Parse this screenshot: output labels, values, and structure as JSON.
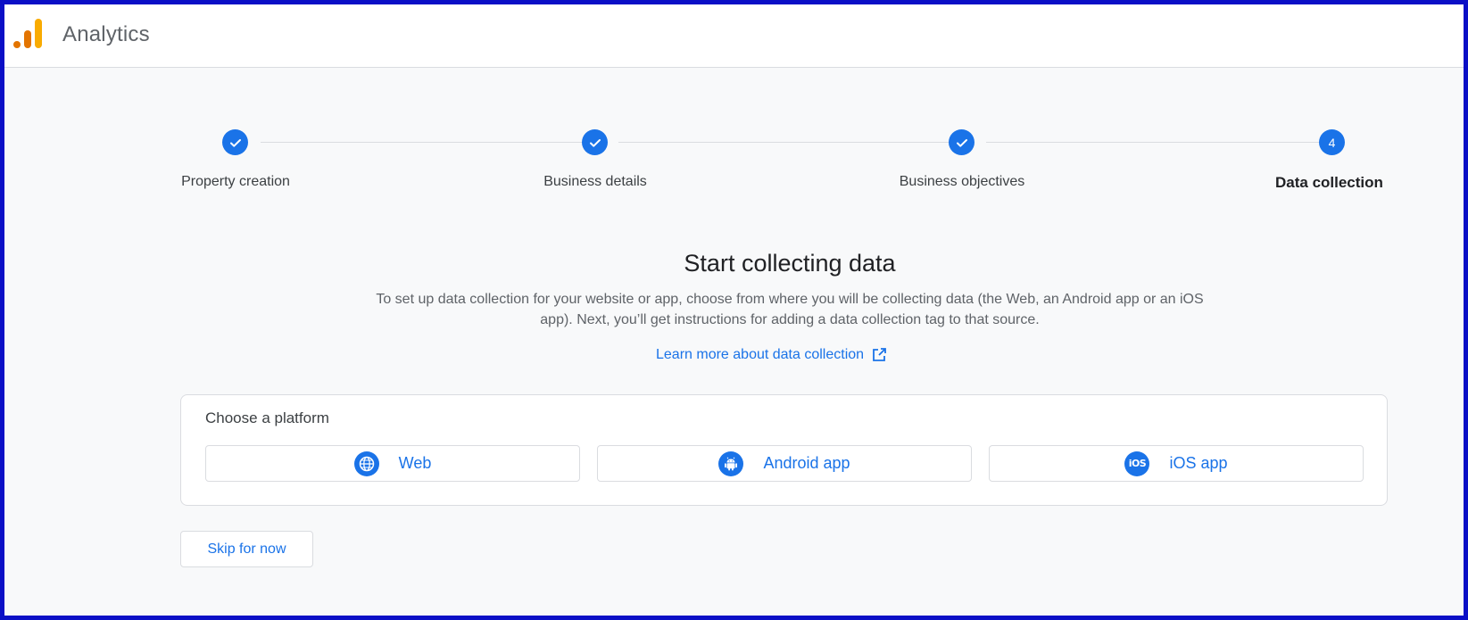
{
  "app": {
    "title": "Analytics",
    "brand_colors": {
      "orange": "#F9AB00",
      "dark_orange": "#E37400"
    }
  },
  "stepper": {
    "steps": [
      {
        "label": "Property creation",
        "status": "complete",
        "icon": "check-icon"
      },
      {
        "label": "Business details",
        "status": "complete",
        "icon": "check-icon"
      },
      {
        "label": "Business objectives",
        "status": "complete",
        "icon": "check-icon"
      },
      {
        "label": "Data collection",
        "status": "current",
        "number": "4"
      }
    ],
    "accent": "#1a73e8"
  },
  "intro": {
    "title": "Start collecting data",
    "description": "To set up data collection for your website or app, choose from where you will be collecting data (the Web, an Android app or an iOS app). Next, you’ll get instructions for adding a data collection tag to that source.",
    "learn_more": "Learn more about data collection",
    "learn_more_icon": "open-in-new-icon"
  },
  "platform": {
    "heading": "Choose a platform",
    "options": [
      {
        "label": "Web",
        "icon": "globe-icon"
      },
      {
        "label": "Android app",
        "icon": "android-icon"
      },
      {
        "label": "iOS app",
        "icon": "ios-icon",
        "icon_text": "iOS"
      }
    ]
  },
  "footer": {
    "skip_label": "Skip for now"
  }
}
